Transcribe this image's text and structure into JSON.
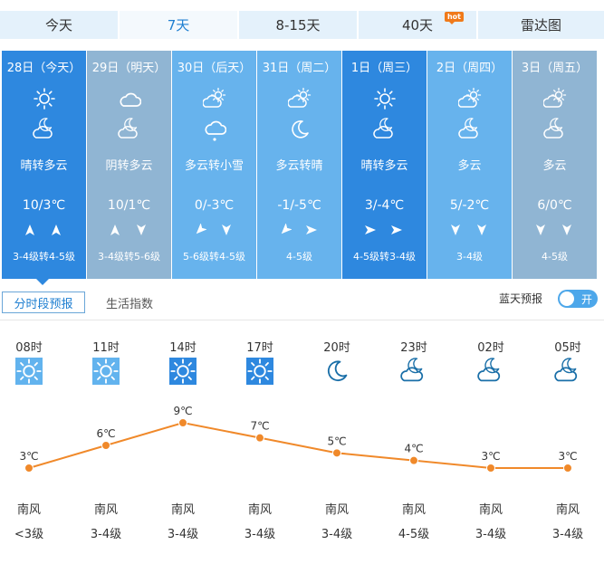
{
  "tabs": [
    {
      "label": "今天",
      "width": 132,
      "active": false
    },
    {
      "label": "7天",
      "width": 132,
      "active": true
    },
    {
      "label": "8-15天",
      "width": 132,
      "active": false
    },
    {
      "label": "40天",
      "width": 132,
      "active": false,
      "badge": "hot"
    },
    {
      "label": "雷达图",
      "width": 139,
      "active": false
    }
  ],
  "days": [
    {
      "date": "28日（今天）",
      "icon1": "sun",
      "icon2": "moon-cloud",
      "cond": "晴转多云",
      "temp": "10/3℃",
      "winds": [
        "up",
        "up"
      ],
      "level": "3-4级转4-5级",
      "bg": "#2e88df"
    },
    {
      "date": "29日（明天）",
      "icon1": "cloud",
      "icon2": "moon-cloud",
      "cond": "阴转多云",
      "temp": "10/1℃",
      "winds": [
        "up",
        "down"
      ],
      "level": "3-4级转5-6级",
      "bg": "#90b5d3"
    },
    {
      "date": "30日（后天）",
      "icon1": "sun-cloud",
      "icon2": "snow-cloud",
      "cond": "多云转小雪",
      "temp": "0/-3℃",
      "winds": [
        "down-left",
        "down"
      ],
      "level": "5-6级转4-5级",
      "bg": "#67b3ed"
    },
    {
      "date": "31日（周二）",
      "icon1": "sun-cloud",
      "icon2": "moon",
      "cond": "多云转晴",
      "temp": "-1/-5℃",
      "winds": [
        "down-left",
        "right"
      ],
      "level": "4-5级",
      "bg": "#67b3ed"
    },
    {
      "date": "1日（周三）",
      "icon1": "sun",
      "icon2": "moon-cloud",
      "cond": "晴转多云",
      "temp": "3/-4℃",
      "winds": [
        "right",
        "right"
      ],
      "level": "4-5级转3-4级",
      "bg": "#2e88df"
    },
    {
      "date": "2日（周四）",
      "icon1": "sun-cloud",
      "icon2": "moon-cloud",
      "cond": "多云",
      "temp": "5/-2℃",
      "winds": [
        "down",
        "down"
      ],
      "level": "3-4级",
      "bg": "#67b3ed"
    },
    {
      "date": "3日（周五）",
      "icon1": "sun-cloud",
      "icon2": "moon-cloud",
      "cond": "多云",
      "temp": "6/0℃",
      "winds": [
        "down",
        "down"
      ],
      "level": "4-5级",
      "bg": "#90b5d3"
    }
  ],
  "subtabs": {
    "active": "分时段预报",
    "other": "生活指数"
  },
  "blue_sky": {
    "label": "蓝天预报",
    "toggle_text": "开"
  },
  "hourly": [
    {
      "time": "08时",
      "icon": "sun-light",
      "temp": 3,
      "temp_label": "3℃",
      "wind": "南风",
      "level": "<3级"
    },
    {
      "time": "11时",
      "icon": "sun-light",
      "temp": 6,
      "temp_label": "6℃",
      "wind": "南风",
      "level": "3-4级"
    },
    {
      "time": "14时",
      "icon": "sun-dark",
      "temp": 9,
      "temp_label": "9℃",
      "wind": "南风",
      "level": "3-4级"
    },
    {
      "time": "17时",
      "icon": "sun-dark",
      "temp": 7,
      "temp_label": "7℃",
      "wind": "南风",
      "level": "3-4级"
    },
    {
      "time": "20时",
      "icon": "moon",
      "temp": 5,
      "temp_label": "5℃",
      "wind": "南风",
      "level": "3-4级"
    },
    {
      "time": "23时",
      "icon": "moon-cloud",
      "temp": 4,
      "temp_label": "4℃",
      "wind": "南风",
      "level": "4-5级"
    },
    {
      "time": "02时",
      "icon": "moon-cloud",
      "temp": 3,
      "temp_label": "3℃",
      "wind": "南风",
      "level": "3-4级"
    },
    {
      "time": "05时",
      "icon": "moon-cloud",
      "temp": 3,
      "temp_label": "3℃",
      "wind": "南风",
      "level": "3-4级"
    }
  ],
  "colors": {
    "line": "#f0892a",
    "tab_active_text": "#1f7fd1",
    "hourly_icon": "#1a6fa8"
  }
}
